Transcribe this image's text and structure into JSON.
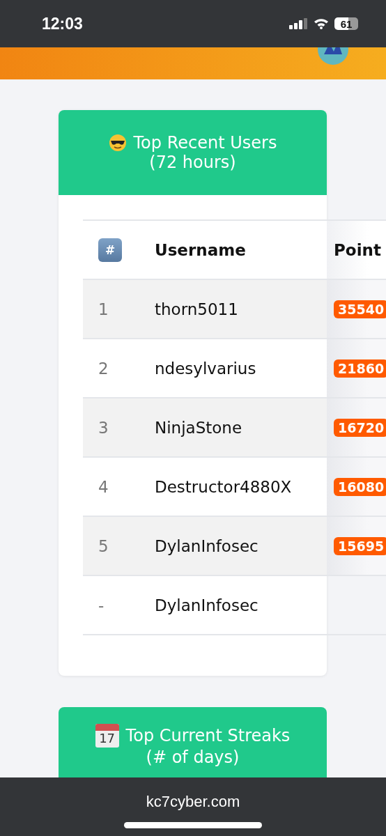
{
  "status_bar": {
    "time": "12:03",
    "battery": "61"
  },
  "leaderboard": {
    "title": "Top Recent Users",
    "subtitle": "(72 hours)",
    "columns": [
      "#",
      "Username",
      "Point"
    ],
    "rows": [
      {
        "rank": "1",
        "username": "thorn5011",
        "points": "35540"
      },
      {
        "rank": "2",
        "username": "ndesylvarius",
        "points": "21860"
      },
      {
        "rank": "3",
        "username": "NinjaStone",
        "points": "16720"
      },
      {
        "rank": "4",
        "username": "Destructor4880X",
        "points": "16080"
      },
      {
        "rank": "5",
        "username": "DylanInfosec",
        "points": "15695"
      },
      {
        "rank": "-",
        "username": "DylanInfosec"
      }
    ]
  },
  "streaks": {
    "calendar_day": "17",
    "title": "Top Current Streaks",
    "subtitle": "(# of days)"
  },
  "browser": {
    "url": "kc7cyber.com"
  }
}
